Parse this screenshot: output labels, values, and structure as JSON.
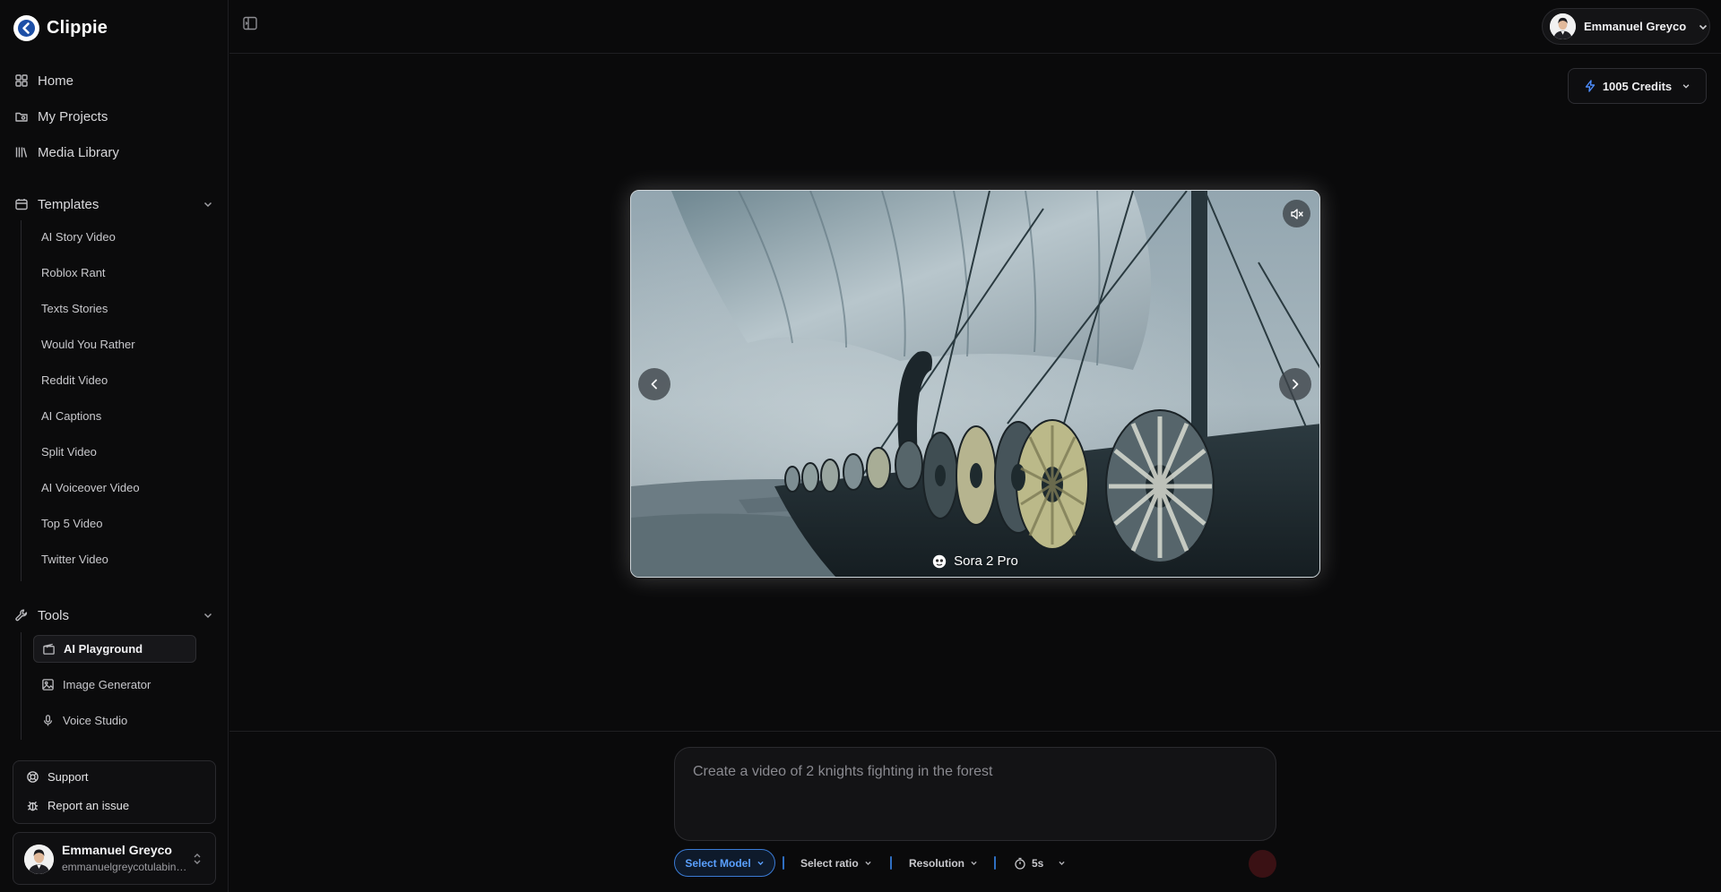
{
  "app": {
    "name": "Clippie"
  },
  "nav": {
    "items": [
      {
        "label": "Home",
        "icon": "grid-icon"
      },
      {
        "label": "My Projects",
        "icon": "folder-icon"
      },
      {
        "label": "Media Library",
        "icon": "library-icon"
      }
    ]
  },
  "templates": {
    "label": "Templates",
    "items": [
      "AI Story Video",
      "Roblox Rant",
      "Texts Stories",
      "Would You Rather",
      "Reddit Video",
      "AI Captions",
      "Split Video",
      "AI Voiceover Video",
      "Top 5 Video",
      "Twitter Video"
    ]
  },
  "tools": {
    "label": "Tools",
    "items": [
      {
        "label": "AI Playground",
        "icon": "clapper-icon",
        "active": true
      },
      {
        "label": "Image Generator",
        "icon": "image-icon",
        "active": false
      },
      {
        "label": "Voice Studio",
        "icon": "mic-icon",
        "active": false
      }
    ]
  },
  "support": {
    "support_label": "Support",
    "report_label": "Report an issue"
  },
  "user": {
    "name": "Emmanuel Greyco",
    "email": "emmanuelgreycotulabing@gmail.com"
  },
  "header": {
    "profile_name": "Emmanuel Greyco",
    "credits_label": "1005 Credits"
  },
  "video": {
    "model_label": "Sora 2 Pro"
  },
  "prompt": {
    "placeholder": "Create a video of 2 knights fighting in the forest"
  },
  "controls": {
    "select_model": "Select Model",
    "select_ratio": "Select ratio",
    "resolution": "Resolution",
    "duration": "5s"
  },
  "colors": {
    "accent": "#3a7bd5",
    "credits_icon": "#4d8dff",
    "background": "#0a0a0b"
  }
}
